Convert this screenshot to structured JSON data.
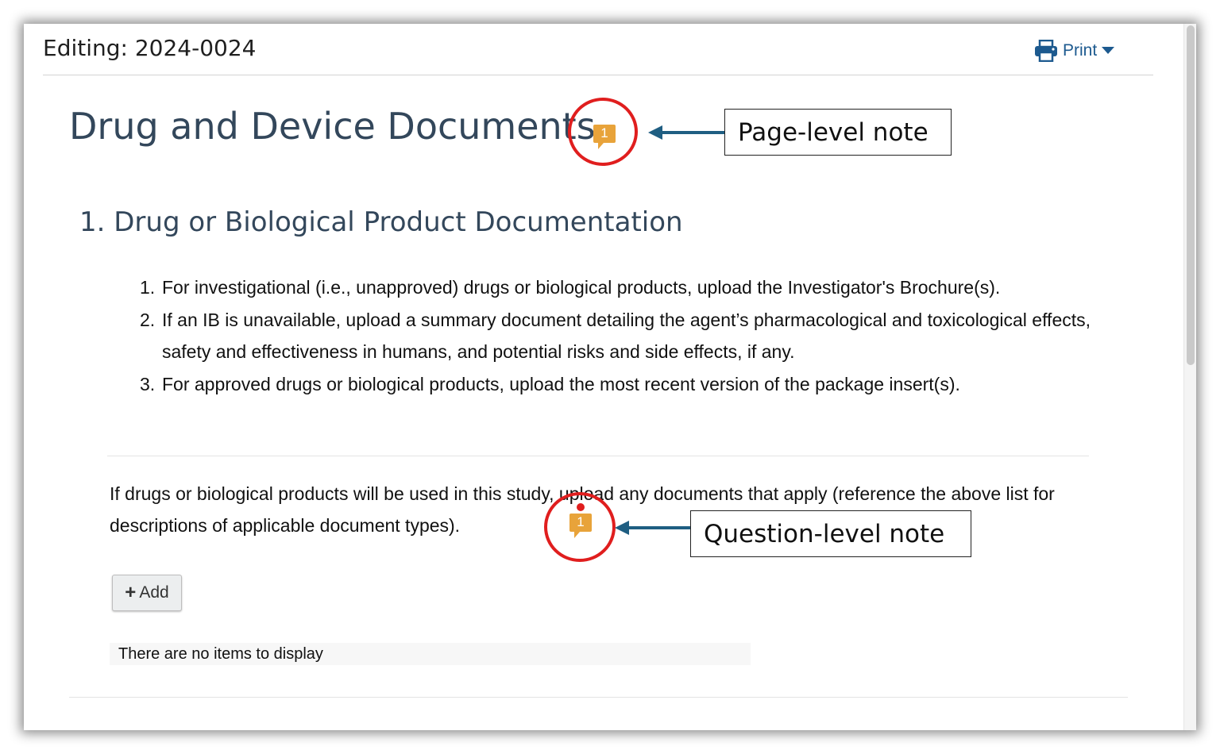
{
  "header": {
    "title": "Editing: 2024-0024",
    "print_label": "Print"
  },
  "page": {
    "title": "Drug and Device Documents",
    "page_note_count": "1"
  },
  "section": {
    "title": "1. Drug or Biological Product Documentation",
    "instructions": [
      {
        "num": "1.",
        "text": "For investigational (i.e., unapproved) drugs or biological products, upload the Investigator's Brochure(s)."
      },
      {
        "num": "2.",
        "text": "If an IB is unavailable, upload a summary document detailing the agent’s pharmacological and toxicological effects, safety and effectiveness in humans, and potential risks and side effects, if any."
      },
      {
        "num": "3.",
        "text": "For approved drugs or biological products, upload the most recent version of the package insert(s)."
      }
    ]
  },
  "question": {
    "text": "If drugs or biological products will be used in this study, upload any documents that apply (reference the above list for descriptions of applicable document types).",
    "note_count": "1",
    "add_label": "Add",
    "empty_text": "There are no items to display"
  },
  "annotations": {
    "page_note_label": "Page-level note",
    "question_note_label": "Question-level note"
  },
  "colors": {
    "title_text": "#33475b",
    "link_blue": "#1d5a8f",
    "note_badge": "#e8a33a",
    "annotation_red": "#e01e1e",
    "arrow": "#1f5e82"
  }
}
